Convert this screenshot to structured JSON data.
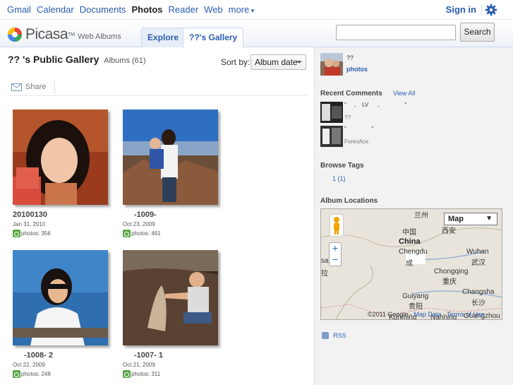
{
  "google_bar": {
    "links": [
      "Gmail",
      "Calendar",
      "Documents",
      "Photos",
      "Reader",
      "Web",
      "more"
    ],
    "active": "Photos",
    "sign_in": "Sign in"
  },
  "header": {
    "logo_word": "Picasa",
    "logo_tm": "TM",
    "logo_sub": "Web Albums",
    "tabs": [
      "Explore",
      "??'s Gallery"
    ],
    "active_tab": "??'s Gallery",
    "search_placeholder": "",
    "search_button": "Search"
  },
  "main": {
    "title": "?? 's Public Gallery",
    "albums_count": "Albums (61)",
    "sort_label": "Sort by:",
    "sort_value": "Album date",
    "share_label": "Share",
    "albums": [
      {
        "title": "20100130",
        "date": "Jan 31, 2010",
        "photos": "photos: 356"
      },
      {
        "title": "-1009-",
        "date": "Oct 23, 2009",
        "photos": "photos: 461"
      },
      {
        "title": "-1008-    2",
        "date": "Oct 22, 2009",
        "photos": "photos: 248"
      },
      {
        "title": "-1007-    1",
        "date": "Oct 21, 2009",
        "photos": "photos: 311"
      }
    ]
  },
  "sidebar": {
    "owner_name": "??",
    "owner_photos": "photos",
    "recent_comments_heading": "Recent Comments",
    "view_all": "View All",
    "comments": [
      {
        "text": "\"     ,    LV      ,                \"",
        "author": "??"
      },
      {
        "text": "\"                \"",
        "author": "ForexAce"
      }
    ],
    "browse_tags_heading": "Browse Tags",
    "tag": "1 (1)",
    "album_locations_heading": "Album Locations",
    "map": {
      "type_label": "Map",
      "labels": [
        "兰州",
        "中国",
        "China",
        "Chengdu",
        "成",
        "西安",
        "Wuhan",
        "武汉",
        "Chongqing",
        "重庆",
        "Changsha",
        "长沙",
        "Guiyang",
        "贵阳",
        "Kunming",
        "Nanning",
        "Guangzhou",
        "sa",
        "拉"
      ],
      "copyright": "©2011 Google - ",
      "map_data_link": "Map Data",
      "terms_link": "Terms of Use"
    },
    "rss": "RSS"
  }
}
